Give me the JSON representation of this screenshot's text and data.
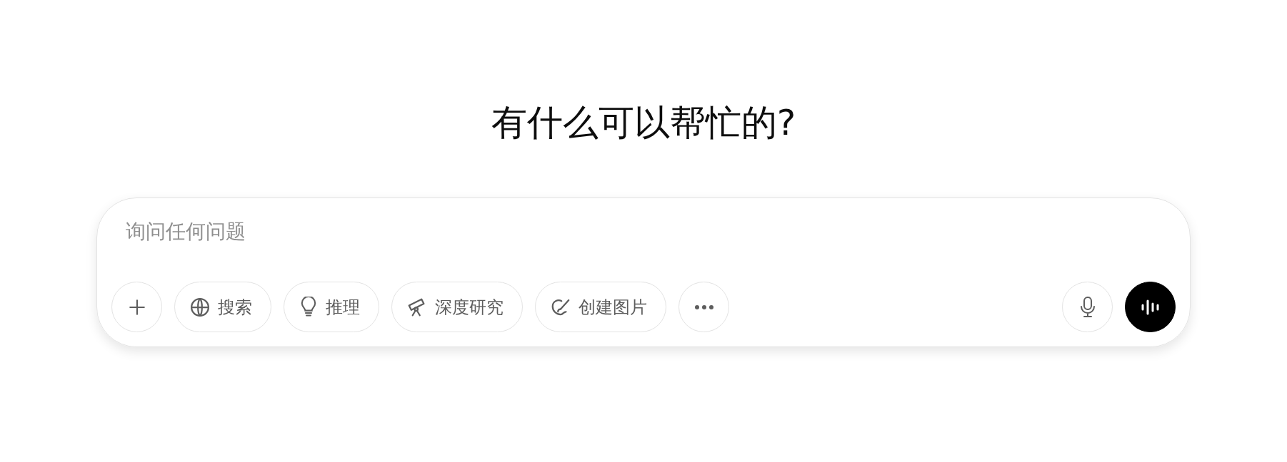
{
  "heading": "有什么可以帮忙的?",
  "composer": {
    "placeholder": "询问任何问题",
    "tools": [
      {
        "label": "搜索"
      },
      {
        "label": "推理"
      },
      {
        "label": "深度研究"
      },
      {
        "label": "创建图片"
      }
    ]
  }
}
